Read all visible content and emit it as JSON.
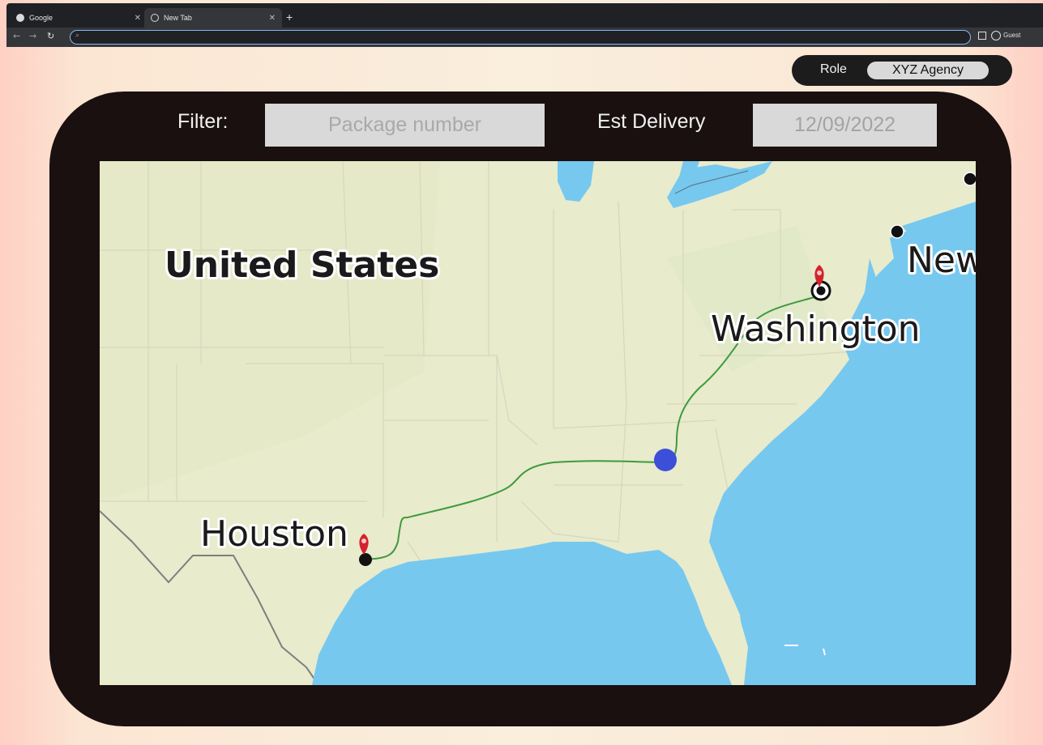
{
  "browser": {
    "tabs": [
      {
        "title": "Google",
        "active": false
      },
      {
        "title": "New Tab",
        "active": true
      }
    ],
    "new_tab_symbol": "+",
    "profile_label": "Guest",
    "icons": [
      "back-icon",
      "forward-icon",
      "reload-icon",
      "search-icon",
      "side-panel-icon",
      "profile-icon"
    ]
  },
  "role": {
    "label": "Role",
    "value": "XYZ Agency"
  },
  "filter": {
    "label": "Filter:",
    "placeholder": "Package number"
  },
  "delivery": {
    "label": "Est Delivery",
    "value": "12/09/2022"
  },
  "map": {
    "country_label": "United States",
    "cities": {
      "origin": "Houston",
      "destination": "Washington",
      "partial": "New"
    },
    "colors": {
      "land": "#e9ecce",
      "water": "#76c8ef",
      "route": "#3e9a3e",
      "current_location": "#3b4fd8",
      "pin": "#d3232b"
    }
  }
}
